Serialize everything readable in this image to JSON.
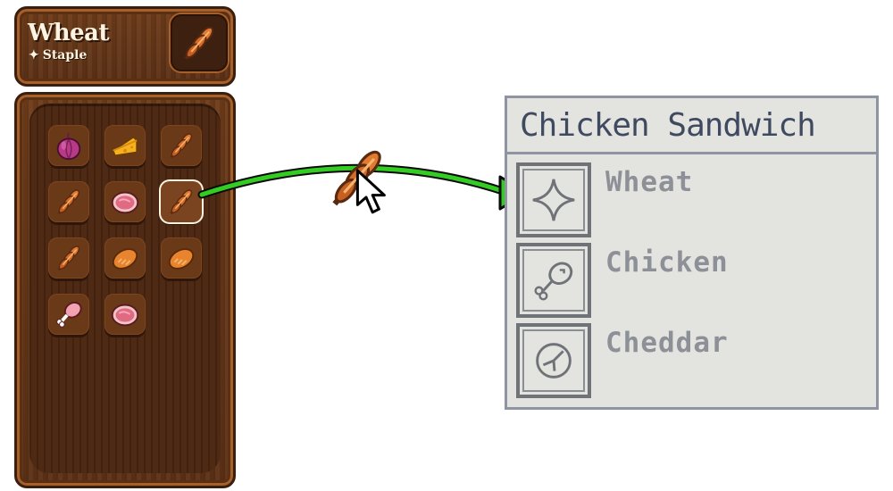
{
  "header": {
    "item_name": "Wheat",
    "item_tag": "Staple",
    "item_icon": "wheat-icon"
  },
  "inventory": {
    "slots": [
      {
        "item": "onion-icon",
        "selected": false
      },
      {
        "item": "cheese-icon",
        "selected": false
      },
      {
        "item": "wheat-icon",
        "selected": false
      },
      {
        "item": "wheat-icon",
        "selected": false
      },
      {
        "item": "meat-icon",
        "selected": false
      },
      {
        "item": "wheat-icon",
        "selected": true
      },
      {
        "item": "wheat-icon",
        "selected": false
      },
      {
        "item": "bread-icon",
        "selected": false
      },
      {
        "item": "bread-icon",
        "selected": false
      },
      {
        "item": "drumstick-icon",
        "selected": false
      },
      {
        "item": "meat-icon",
        "selected": false
      }
    ]
  },
  "drag": {
    "item": "wheat-icon",
    "arrow_color": "#33cc22"
  },
  "recipe": {
    "title": "Chicken Sandwich",
    "ingredients": [
      {
        "label": "Wheat",
        "icon": "sparkle-outline-icon"
      },
      {
        "label": "Chicken",
        "icon": "drumstick-outline-icon"
      },
      {
        "label": "Cheddar",
        "icon": "cheese-wheel-outline-icon"
      }
    ]
  }
}
